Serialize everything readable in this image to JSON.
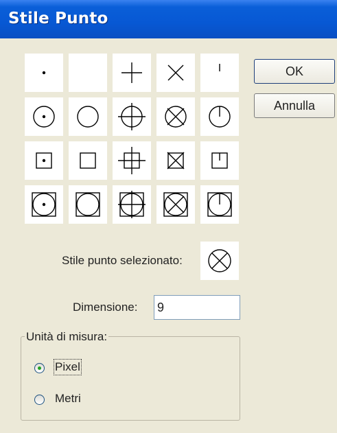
{
  "window": {
    "title": "Stile Punto"
  },
  "buttons": {
    "ok": "OK",
    "cancel": "Annulla"
  },
  "point_styles": [
    [
      "dot",
      "blank",
      "plus",
      "cross",
      "tick"
    ],
    [
      "circle-dot",
      "circle",
      "circle-plus",
      "circle-cross",
      "circle-tick"
    ],
    [
      "square-dot",
      "square",
      "square-plus",
      "square-cross",
      "square-tick"
    ],
    [
      "circle-square-dot",
      "circle-square",
      "circle-square-plus",
      "circle-square-cross",
      "circle-square-tick"
    ]
  ],
  "selected_style": {
    "label": "Stile punto selezionato:",
    "style": "circle-cross"
  },
  "size": {
    "label": "Dimensione:",
    "value": "9"
  },
  "units": {
    "legend": "Unità di misura:",
    "options": [
      {
        "label": "Pixel",
        "selected": true
      },
      {
        "label": "Metri",
        "selected": false
      }
    ]
  }
}
